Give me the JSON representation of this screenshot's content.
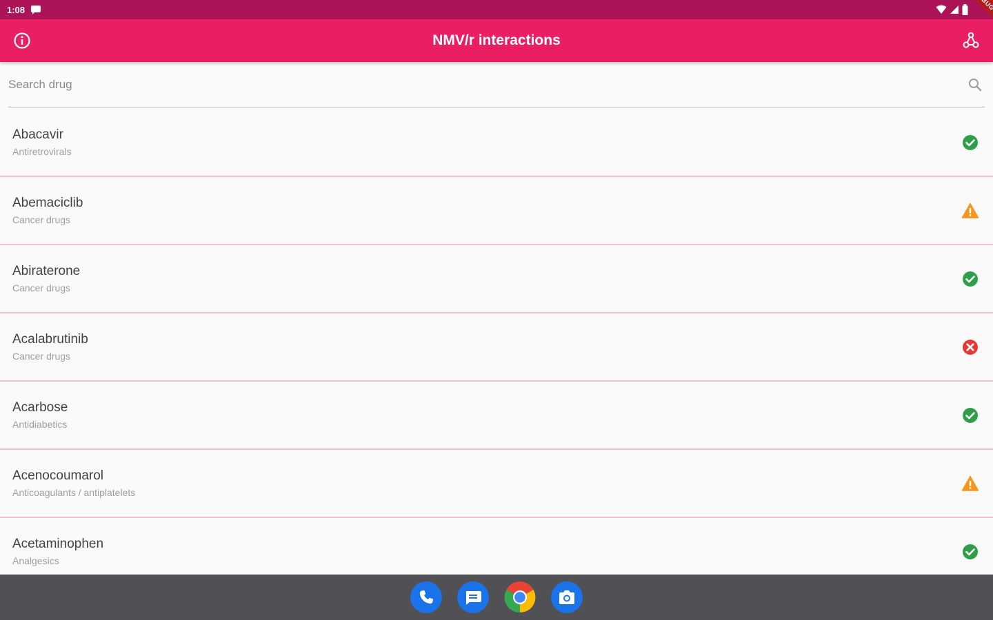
{
  "status_bar": {
    "time": "1:08",
    "colors": {
      "background": "#ad1457"
    }
  },
  "debug_banner": {
    "label": "DEBUG"
  },
  "app_bar": {
    "title": "NMV/r interactions",
    "left_icon": "info-icon",
    "right_icon": "molecule-icon",
    "background": "#e91e63"
  },
  "search": {
    "placeholder": "Search drug",
    "value": "",
    "icon": "search-icon"
  },
  "status_colors": {
    "ok": "#2e9e48",
    "warning": "#f5961e",
    "danger": "#e53935"
  },
  "drugs": [
    {
      "name": "Abacavir",
      "class": "Antiretrovirals",
      "status": "ok"
    },
    {
      "name": "Abemaciclib",
      "class": "Cancer drugs",
      "status": "warning"
    },
    {
      "name": "Abiraterone",
      "class": "Cancer drugs",
      "status": "ok"
    },
    {
      "name": "Acalabrutinib",
      "class": "Cancer drugs",
      "status": "danger"
    },
    {
      "name": "Acarbose",
      "class": "Antidiabetics",
      "status": "ok"
    },
    {
      "name": "Acenocoumarol",
      "class": "Anticoagulants / antiplatelets",
      "status": "warning"
    },
    {
      "name": "Acetaminophen",
      "class": "Analgesics",
      "status": "ok"
    }
  ],
  "dock": [
    {
      "name": "phone-app-icon"
    },
    {
      "name": "messages-app-icon"
    },
    {
      "name": "chrome-app-icon"
    },
    {
      "name": "camera-app-icon"
    }
  ]
}
